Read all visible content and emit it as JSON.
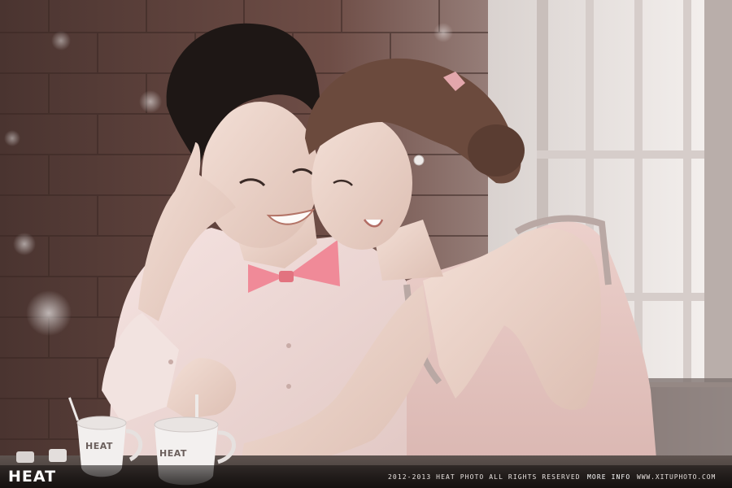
{
  "footer": {
    "brand": "HEAT",
    "copyright": "2012-2013  HEAT PHOTO ALL RIGHTS RESERVED",
    "more_info": "MORE INFO",
    "site_url": "WWW.XITUPHOTO.COM"
  },
  "cups": {
    "left_cup_logo": "HEAT",
    "right_cup_logo": "HEAT"
  },
  "colors": {
    "shirt": "#f2d9d6",
    "dress": "#e8c5c0",
    "bowtie": "#f08a98",
    "brick": "#7a4a40",
    "window": "#f4efec"
  }
}
